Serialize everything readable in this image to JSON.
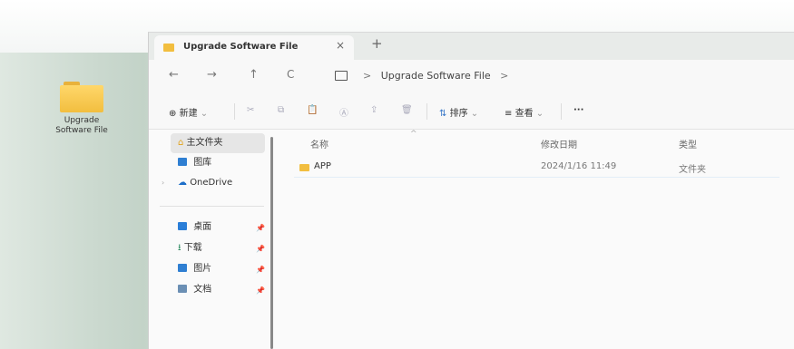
{
  "desktop": {
    "icon_label_line1": "Upgrade",
    "icon_label_line2": "Software File"
  },
  "window": {
    "tab_title": "Upgrade Software File",
    "tab_close": "×",
    "tab_add": "+",
    "nav": {
      "back": "←",
      "forward": "→",
      "up": "↑",
      "refresh": "C",
      "path_sep1": ">",
      "path_item": "Upgrade Software File",
      "path_sep2": ">"
    },
    "toolbar": {
      "new_label": "新建",
      "new_icon": "⊕",
      "new_caret": "⌄",
      "sort_label": "排序",
      "sort_icon": "⇅",
      "sort_caret": "⌄",
      "view_label": "查看",
      "view_icon": "≡",
      "view_caret": "⌄",
      "more": "···"
    },
    "sidebar": {
      "home": "主文件夹",
      "gallery": "图库",
      "onedrive": "OneDrive",
      "desktop": "桌面",
      "downloads": "下载",
      "pictures": "图片",
      "documents": "文档"
    },
    "columns": {
      "name": "名称",
      "date": "修改日期",
      "type": "类型"
    },
    "files": [
      {
        "name": "APP",
        "date": "2024/1/16 11:49",
        "type": "文件夹"
      }
    ]
  }
}
